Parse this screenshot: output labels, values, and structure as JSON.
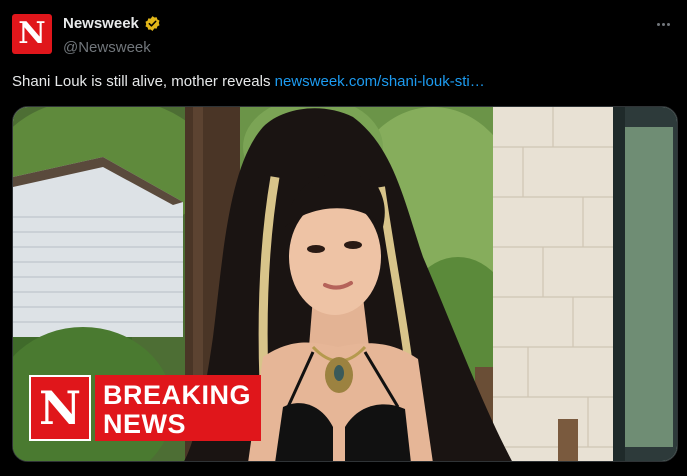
{
  "tweet": {
    "avatar_letter": "N",
    "display_name": "Newsweek",
    "handle": "@Newsweek",
    "text": "Shani Louk is still alive, mother reveals",
    "link_text": "newsweek.com/shani-louk-sti…",
    "verified_badge_color": "#e2b719",
    "link_color": "#1d9bf0",
    "brand_color": "#e0161b",
    "more_icon": "more-horizontal-icon"
  },
  "media": {
    "badge_letter": "N",
    "badge_line1": "BREAKING",
    "badge_line2": "NEWS"
  }
}
